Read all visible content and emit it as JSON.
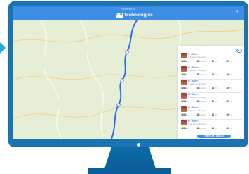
{
  "app": {
    "header_subtitle": "Powered by",
    "logo_mark": "CA",
    "logo_text": "technologies",
    "close_icon": "close-icon"
  },
  "panel": {
    "cards": [
      {
        "name": "H. Pierre",
        "subtitle": "Transport Manager",
        "stats": [
          {
            "value": "408",
            "unit": "km"
          },
          {
            "value": "14",
            "unit": "heures"
          },
          {
            "value": "48",
            "unit": "%"
          },
          {
            "value": "20",
            "unit": "%"
          }
        ]
      },
      {
        "name": "H. Pierre",
        "subtitle": "Transport Manager",
        "stats": [
          {
            "value": "408",
            "unit": "km"
          },
          {
            "value": "14",
            "unit": "heures"
          },
          {
            "value": "48",
            "unit": "%"
          },
          {
            "value": "20",
            "unit": "%"
          }
        ]
      },
      {
        "name": "H. Pierre",
        "subtitle": "Transport Manager",
        "stats": [
          {
            "value": "408",
            "unit": "km"
          },
          {
            "value": "14",
            "unit": "heures"
          },
          {
            "value": "48",
            "unit": "%"
          },
          {
            "value": "20",
            "unit": "%"
          }
        ]
      },
      {
        "name": "D. Pierre",
        "subtitle": "Transport Manager",
        "stats": [
          {
            "value": "408",
            "unit": "km"
          },
          {
            "value": "14",
            "unit": "heures"
          },
          {
            "value": "48",
            "unit": "%"
          },
          {
            "value": "20",
            "unit": "%"
          }
        ]
      },
      {
        "name": "H. Pierre",
        "subtitle": "Transport Manager",
        "stats": [
          {
            "value": "408",
            "unit": "km"
          },
          {
            "value": "14",
            "unit": "heures"
          },
          {
            "value": "48",
            "unit": "%"
          },
          {
            "value": "20",
            "unit": "%"
          }
        ]
      },
      {
        "name": "H. Pierre",
        "subtitle": "Transport Manager",
        "stats": [
          {
            "value": "408",
            "unit": "km"
          },
          {
            "value": "14",
            "unit": "heures"
          },
          {
            "value": "48",
            "unit": "%"
          },
          {
            "value": "20",
            "unit": "%"
          }
        ]
      }
    ],
    "cta_label": "VOIR PLUS · DÉTAILS",
    "eye_icon": "eye-icon"
  },
  "colors": {
    "accent": "#3f8ee5",
    "monitor": "#1a73b3",
    "map_bg": "#e8f0d9",
    "route": "#2a6df4"
  }
}
